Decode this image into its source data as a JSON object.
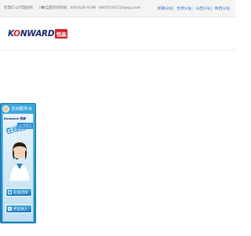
{
  "topbar": {
    "site_slogan": "智慧矿山代理招商：",
    "hotline": "[☎全国咨询热线：400-628-9198",
    "email": "[✉876191210@qq.com",
    "substations": [
      "新疆分站",
      "甘肃分站",
      "山西分站",
      "陕西分站"
    ],
    "separator": "|"
  },
  "header": {
    "logo_text_main": "KONWARD",
    "logo_text_accent": "O",
    "logo_cn": "恒森"
  },
  "widget": {
    "title": "咨询服务台",
    "brand": "Konward 恒森",
    "tag": "在线客服",
    "slogan": "在线咨询",
    "button_online": "在线咨询",
    "button_enter": "点击进入",
    "brand_color": "#1d84c6"
  }
}
